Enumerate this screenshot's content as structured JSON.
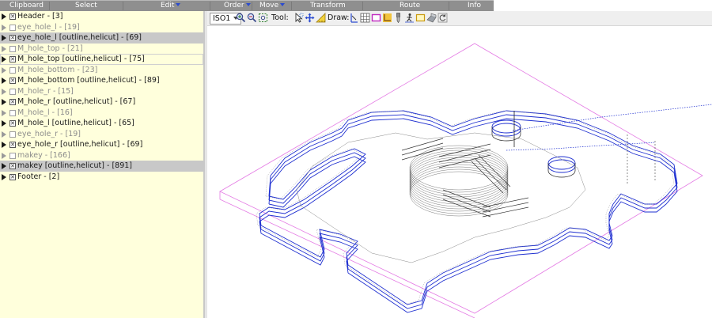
{
  "menubar": {
    "items": [
      {
        "label": "Clipboard",
        "has_caret": false
      },
      {
        "label": "Select",
        "has_caret": false
      },
      {
        "label": "Edit",
        "has_caret": true
      },
      {
        "label": "Order",
        "has_caret": true
      },
      {
        "label": "Move",
        "has_caret": true
      },
      {
        "label": "Transform",
        "has_caret": false
      },
      {
        "label": "Route",
        "has_caret": false
      },
      {
        "label": "Info",
        "has_caret": false
      }
    ]
  },
  "tree": {
    "rows": [
      {
        "label": "Header - [3]",
        "checked": true,
        "enabled": true,
        "selected": false
      },
      {
        "label": "eye_hole_l - [19]",
        "checked": false,
        "enabled": false,
        "selected": false
      },
      {
        "label": "eye_hole_l [outline,helicut] - [69]",
        "checked": true,
        "enabled": true,
        "selected": true
      },
      {
        "label": "M_hole_top - [21]",
        "checked": false,
        "enabled": false,
        "selected": false
      },
      {
        "label": "M_hole_top [outline,helicut] - [75]",
        "checked": true,
        "enabled": true,
        "selected": false,
        "outlined": true
      },
      {
        "label": "M_hole_bottom - [23]",
        "checked": false,
        "enabled": false,
        "selected": false
      },
      {
        "label": "M_hole_bottom [outline,helicut] - [89]",
        "checked": true,
        "enabled": true,
        "selected": false
      },
      {
        "label": "M_hole_r - [15]",
        "checked": false,
        "enabled": false,
        "selected": false
      },
      {
        "label": "M_hole_r [outline,helicut] - [67]",
        "checked": true,
        "enabled": true,
        "selected": false
      },
      {
        "label": "M_hole_l - [16]",
        "checked": false,
        "enabled": false,
        "selected": false
      },
      {
        "label": "M_hole_l [outline,helicut] - [65]",
        "checked": true,
        "enabled": true,
        "selected": false
      },
      {
        "label": "eye_hole_r - [19]",
        "checked": false,
        "enabled": false,
        "selected": false
      },
      {
        "label": "eye_hole_r [outline,helicut] - [69]",
        "checked": true,
        "enabled": true,
        "selected": false
      },
      {
        "label": "makey - [166]",
        "checked": false,
        "enabled": false,
        "selected": false
      },
      {
        "label": "makey [outline,helicut] - [891]",
        "checked": true,
        "enabled": true,
        "selected": true
      },
      {
        "label": "Footer - [2]",
        "checked": true,
        "enabled": true,
        "selected": false
      }
    ]
  },
  "toolbar": {
    "view_label": "ISO1",
    "tool_label": "Tool:",
    "draw_label": "Draw:",
    "view_icons": [
      "zoom-in-icon",
      "zoom-out-icon",
      "zoom-fit-icon"
    ],
    "tool_icons": [
      "select-arrow-icon",
      "pan-move-icon",
      "measure-icon"
    ],
    "draw_icons": [
      "pointer-icon",
      "grid-icon",
      "rectangle-icon",
      "axis-icon",
      "tool-bit-icon",
      "path-runner-icon",
      "box-icon",
      "shade-icon",
      "reset-icon"
    ]
  },
  "colors": {
    "menubar_bg": "#8f8f8f",
    "tree_bg": "#ffffdc",
    "tree_selected_bg": "#c8c8c8",
    "toolpath_blue": "#1e2fd0",
    "boundary_magenta": "#e47be4",
    "outline_gray": "#8a8a8a"
  }
}
